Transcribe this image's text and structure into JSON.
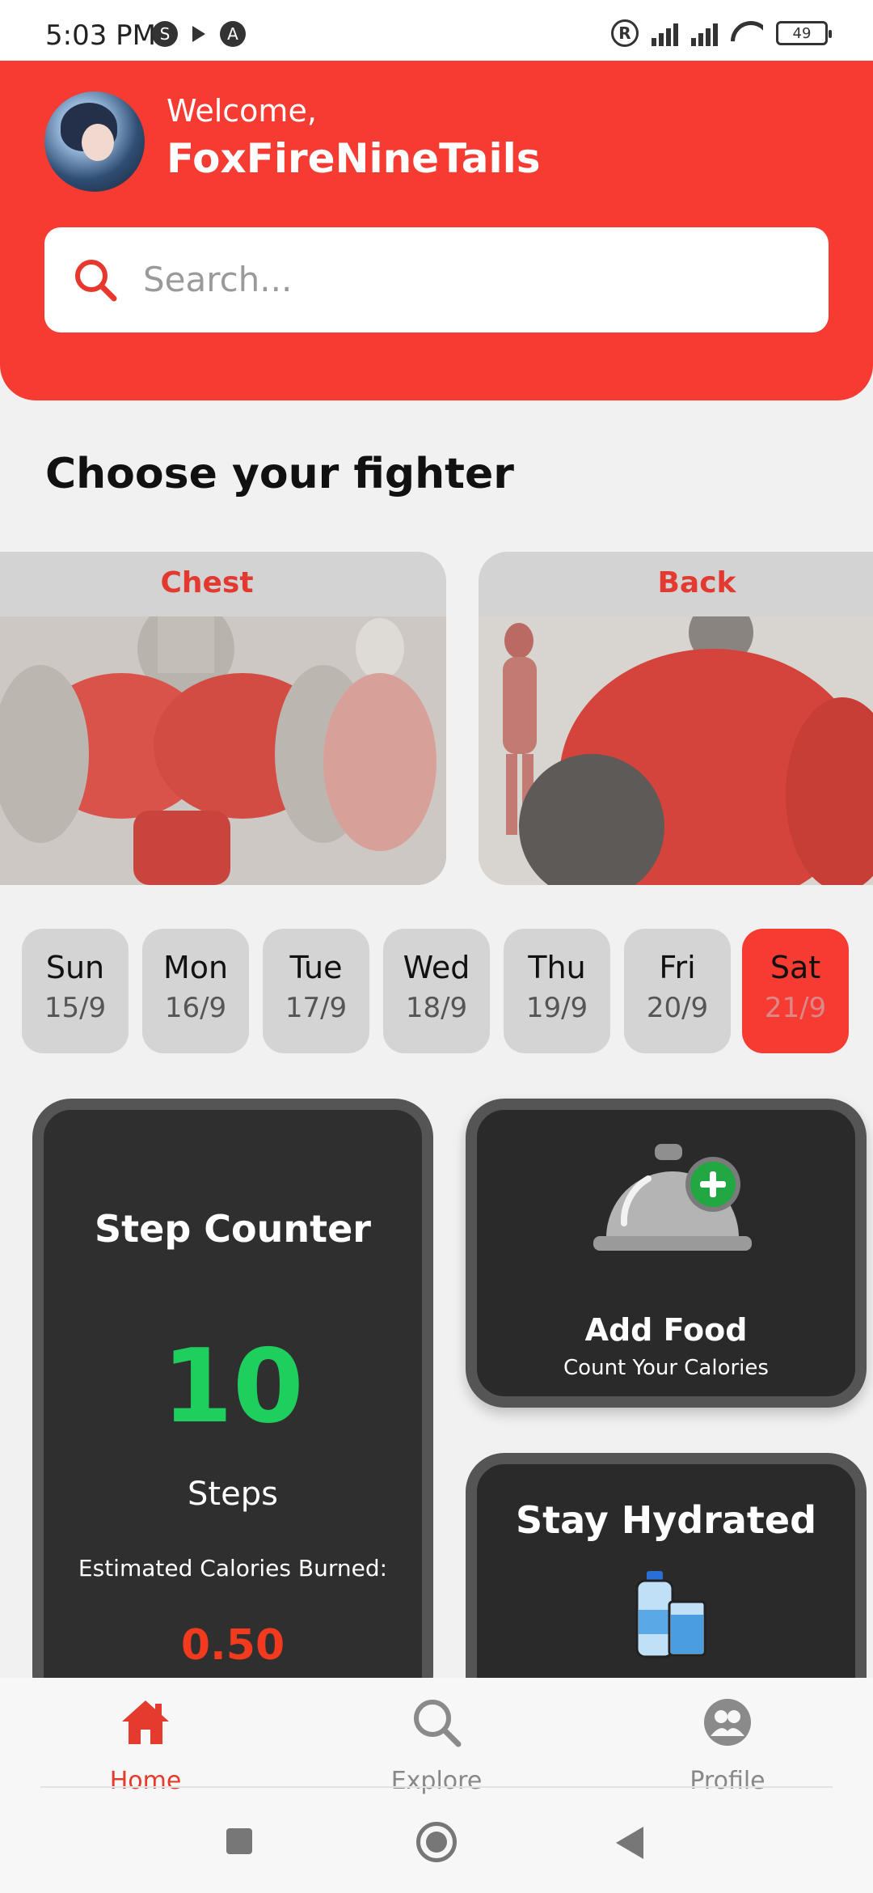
{
  "status_bar": {
    "time": "5:03 PM",
    "battery": "49",
    "registered_mark": "R",
    "s_badge": "S",
    "a_badge": "A"
  },
  "header": {
    "welcome": "Welcome,",
    "username": "FoxFireNineTails",
    "search_placeholder": "Search...",
    "accent_color": "#f63b33"
  },
  "section_title": "Choose your fighter",
  "muscle_groups": [
    {
      "label": "Chest"
    },
    {
      "label": "Back"
    }
  ],
  "days": [
    {
      "name": "Sun",
      "date": "15/9"
    },
    {
      "name": "Mon",
      "date": "16/9"
    },
    {
      "name": "Tue",
      "date": "17/9"
    },
    {
      "name": "Wed",
      "date": "18/9"
    },
    {
      "name": "Thu",
      "date": "19/9"
    },
    {
      "name": "Fri",
      "date": "20/9"
    },
    {
      "name": "Sat",
      "date": "21/9"
    }
  ],
  "selected_day": "Sat",
  "step_counter": {
    "title": "Step Counter",
    "count": "10",
    "unit": "Steps",
    "calories_label": "Estimated Calories Burned:",
    "calories_value": "0.50"
  },
  "add_food": {
    "title": "Add Food",
    "subtitle": "Count Your Calories",
    "icon": "cloche-add-icon"
  },
  "hydration": {
    "title": "Stay Hydrated",
    "icon": "water-bottle-icon"
  },
  "bottom_nav": {
    "items": [
      {
        "label": "Home",
        "icon": "home-icon",
        "active": true
      },
      {
        "label": "Explore",
        "icon": "search-icon",
        "active": false
      },
      {
        "label": "Profile",
        "icon": "profile-icon",
        "active": false
      }
    ]
  }
}
